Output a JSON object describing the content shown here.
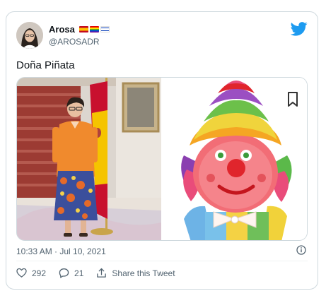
{
  "tweet": {
    "author_name": "Arosa",
    "handle": "@AROSADR",
    "text": "Doña Piñata",
    "timestamp": "10:33 AM · Jul 10, 2021",
    "flags": [
      "spain-flag-icon",
      "rainbow-flag-icon",
      "israel-flag-icon"
    ]
  },
  "actions": {
    "likes": "292",
    "replies": "21",
    "share_label": "Share this Tweet"
  },
  "colors": {
    "twitter_blue": "#1d9bf0",
    "muted": "#536471",
    "border": "#cfd9de"
  }
}
